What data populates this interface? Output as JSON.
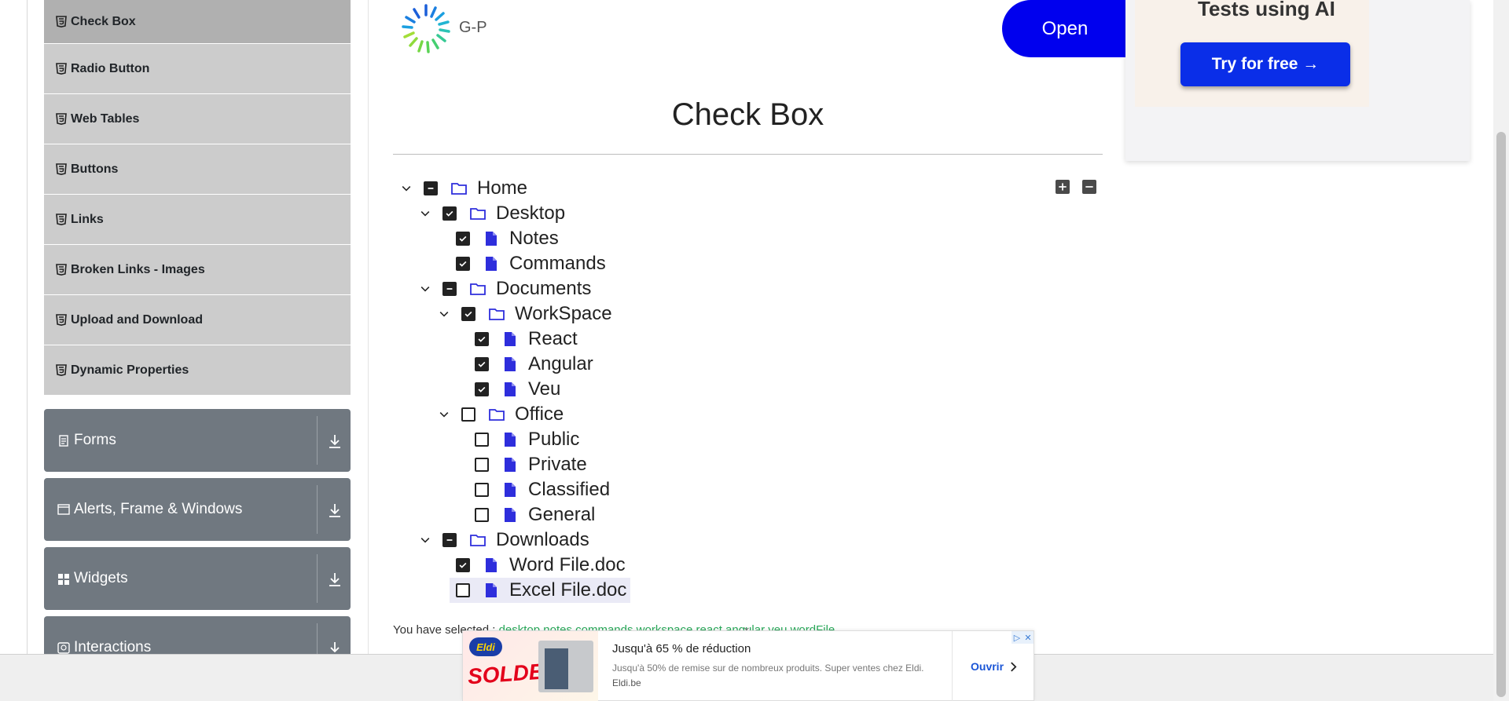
{
  "sidebar": {
    "elements": [
      {
        "label": "Check Box",
        "active": true
      },
      {
        "label": "Radio Button"
      },
      {
        "label": "Web Tables"
      },
      {
        "label": "Buttons"
      },
      {
        "label": "Links"
      },
      {
        "label": "Broken Links - Images"
      },
      {
        "label": "Upload and Download"
      },
      {
        "label": "Dynamic Properties"
      }
    ],
    "groups": [
      {
        "label": "Forms",
        "icon": "document-icon"
      },
      {
        "label": "Alerts, Frame & Windows",
        "icon": "window-icon"
      },
      {
        "label": "Widgets",
        "icon": "grid-icon"
      },
      {
        "label": "Interactions",
        "icon": "refresh-icon"
      }
    ]
  },
  "header": {
    "logo_text": "G-P",
    "open_button": "Open",
    "ad_headline": "Tests using AI",
    "ad_cta": "Try for free →"
  },
  "main": {
    "title": "Check Box",
    "tree": {
      "home": "Home",
      "desktop": "Desktop",
      "notes": "Notes",
      "commands": "Commands",
      "documents": "Documents",
      "workspace": "WorkSpace",
      "react": "React",
      "angular": "Angular",
      "veu": "Veu",
      "office": "Office",
      "public": "Public",
      "private": "Private",
      "classified": "Classified",
      "general": "General",
      "downloads": "Downloads",
      "word": "Word File.doc",
      "excel": "Excel File.doc"
    },
    "result_label": "You have selected :",
    "result_items": "desktop notes commands workspace react angular veu wordFile"
  },
  "bottom_ad": {
    "brand": "Eldi",
    "banner": "SOLDES!",
    "headline": "Jusqu'à 65 % de réduction",
    "description": "Jusqu'à 50% de remise sur de nombreux produits. Super ventes chez Eldi.",
    "domain": "Eldi.be",
    "cta": "Ouvrir"
  },
  "colors": {
    "accent_blue": "#0000ee",
    "group_gray": "#707880",
    "item_gray": "#cccccc",
    "selected_green": "#2aa95a"
  }
}
